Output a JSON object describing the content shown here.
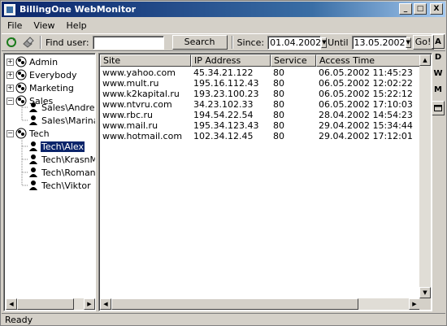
{
  "window": {
    "title": "BillingOne WebMonitor",
    "min": "_",
    "max": "□",
    "close": "X"
  },
  "menu": [
    "File",
    "View",
    "Help"
  ],
  "toolbar": {
    "find_label": "Find user:",
    "find_value": "",
    "search_label": "Search",
    "since_label": "Since:",
    "since_value": "01.04.2002",
    "until_label": "Until",
    "until_value": "13.05.2002",
    "go_label": "Go!"
  },
  "side_buttons": [
    "A",
    "D",
    "W",
    "M"
  ],
  "tree": {
    "groups": [
      "Admin",
      "Everybody",
      "Marketing",
      "Sales",
      "Tech"
    ],
    "sales_users": [
      "Sales\\AndreyP",
      "Sales\\Marina"
    ],
    "tech_users": [
      "Tech\\Alex",
      "Tech\\KrasnMax",
      "Tech\\RomanR",
      "Tech\\Viktor"
    ]
  },
  "table": {
    "columns": [
      "Site",
      "IP Address",
      "Service",
      "Access Time"
    ],
    "rows": [
      [
        "www.yahoo.com",
        "45.34.21.122",
        "80",
        "06.05.2002 11:45:23"
      ],
      [
        "www.mult.ru",
        "195.16.112.43",
        "80",
        "06.05.2002 12:02:22"
      ],
      [
        "www.k2kapital.ru",
        "193.23.100.23",
        "80",
        "06.05.2002 15:22:12"
      ],
      [
        "www.ntvru.com",
        "34.23.102.33",
        "80",
        "06.05.2002 17:10:03"
      ],
      [
        "www.rbc.ru",
        "194.54.22.54",
        "80",
        "28.04.2002 14:54:23"
      ],
      [
        "www.mail.ru",
        "195.34.123.43",
        "80",
        "29.04.2002 15:34:44"
      ],
      [
        "www.hotmail.com",
        "102.34.12.45",
        "80",
        "29.04.2002 17:12:01"
      ]
    ]
  },
  "status": "Ready",
  "colors": {
    "titlebar": "#0a246a",
    "face": "#d4d0c8",
    "selection": "#0a246a"
  },
  "icons": [
    "refresh-icon",
    "connect-icon",
    "group-icon",
    "user-icon"
  ]
}
